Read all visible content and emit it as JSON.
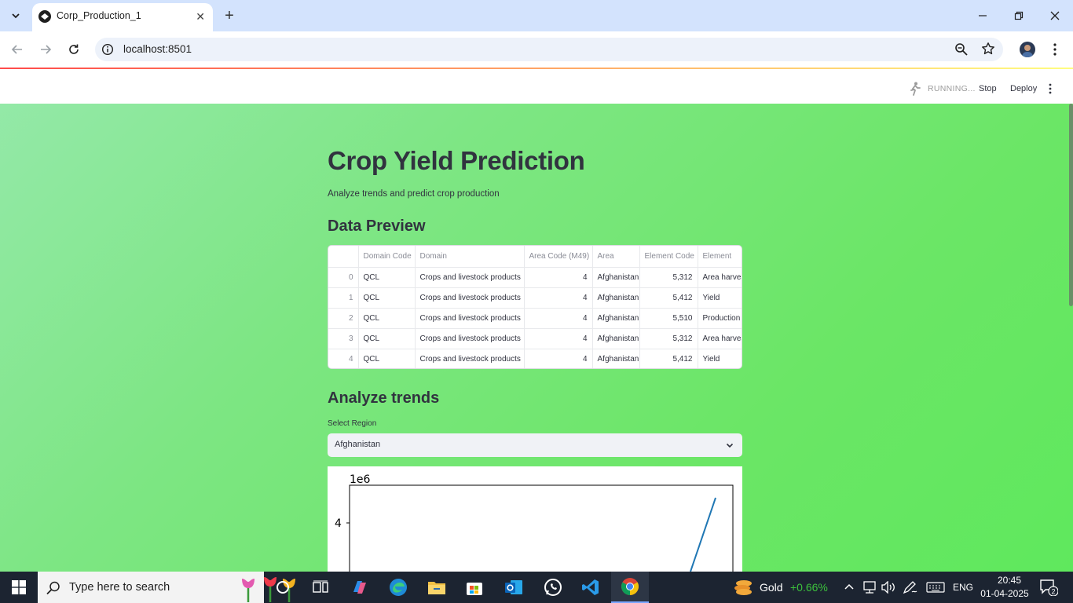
{
  "browser": {
    "tab_title": "Corp_Production_1",
    "url": "localhost:8501"
  },
  "streamlit_header": {
    "status": "RUNNING...",
    "stop_label": "Stop",
    "deploy_label": "Deploy"
  },
  "app": {
    "title": "Crop Yield Prediction",
    "subtitle": "Analyze trends and predict crop production",
    "preview_heading": "Data Preview",
    "table": {
      "columns": [
        "",
        "Domain Code",
        "Domain",
        "Area Code (M49)",
        "Area",
        "Element Code",
        "Element"
      ],
      "rows": [
        [
          "0",
          "QCL",
          "Crops and livestock products",
          "4",
          "Afghanistan",
          "5,312",
          "Area harvested"
        ],
        [
          "1",
          "QCL",
          "Crops and livestock products",
          "4",
          "Afghanistan",
          "5,412",
          "Yield"
        ],
        [
          "2",
          "QCL",
          "Crops and livestock products",
          "4",
          "Afghanistan",
          "5,510",
          "Production"
        ],
        [
          "3",
          "QCL",
          "Crops and livestock products",
          "4",
          "Afghanistan",
          "5,312",
          "Area harvested"
        ],
        [
          "4",
          "QCL",
          "Crops and livestock products",
          "4",
          "Afghanistan",
          "5,412",
          "Yield"
        ]
      ]
    },
    "trends_heading": "Analyze trends",
    "region_label": "Select Region",
    "region_value": "Afghanistan",
    "chart_data": {
      "type": "line",
      "offset_label": "1e6",
      "yticks": [
        "4"
      ],
      "series_color": "#1f77b4"
    }
  },
  "taskbar": {
    "search_placeholder": "Type here to search",
    "gold_label": "Gold",
    "gold_change": "+0.66%",
    "language": "ENG",
    "time": "20:45",
    "date": "01-04-2025",
    "notification_count": "2"
  }
}
